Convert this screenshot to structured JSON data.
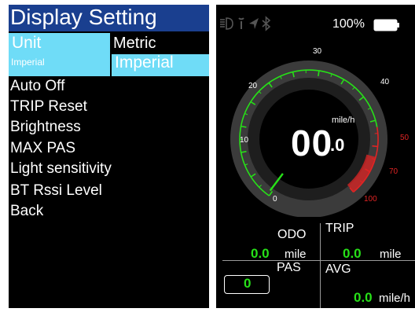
{
  "settings": {
    "title": "Display Setting",
    "unit_label": "Unit",
    "unit_current": "Imperial",
    "unit_options": [
      "Metric",
      "Imperial"
    ],
    "menu": [
      "Auto Off",
      "TRIP Reset",
      "Brightness",
      "MAX PAS",
      "Light sensitivity",
      "BT Rssi Level",
      "Back"
    ]
  },
  "dashboard": {
    "battery": "100%",
    "speed_int": "00",
    "speed_dec": ".0",
    "speed_unit": "mile/h",
    "gauge_ticks": [
      "0",
      "10",
      "20",
      "30",
      "40",
      "50",
      "70",
      "100"
    ],
    "odo_label": "ODO",
    "odo_value": "0.0",
    "odo_unit": "mile",
    "trip_label": "TRIP",
    "trip_value": "0.0",
    "trip_unit": "mile",
    "pas_label": "PAS",
    "pas_value": "0",
    "avg_label": "AVG",
    "avg_value": "0.0",
    "avg_unit": "mile/h"
  },
  "icons": [
    "headlight-icon",
    "wrench-icon",
    "navigation-icon",
    "bluetooth-icon",
    "battery-icon"
  ],
  "colors": {
    "title_bar": "#1a3f8f",
    "highlight": "#6fdcf7",
    "value_green": "#27e018",
    "gauge_green": "#27e018",
    "gauge_red": "#e02424"
  }
}
